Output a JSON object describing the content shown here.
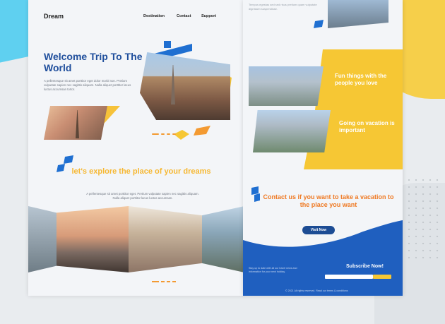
{
  "left_page": {
    "logo": "Dream",
    "nav": [
      "Destination",
      "Contact",
      "Support"
    ],
    "hero_title": "Welcome Trip To The World",
    "hero_text": "A pellentesque sit amet porttitor eget dolor morbi non. Pretium vulputate sapien nec sagittis aliquam. Nulla aliquet porttitor lacus luctus accumsan tortor.",
    "explore_title": "let's explore the place of your dreams",
    "explore_text": "A pellentesque sit amet porttitor eget. Pretium vulputate sapien nec sagittis aliquam. Nulla aliquet porttitor lacus luctus accumsan."
  },
  "right_page": {
    "top_text": "Tempus egestas sed sed risus pretium quam vulputate dignissim suspendisse.",
    "fun_text": "Fun things with the people you love",
    "vacation_text": "Going on vacation is important",
    "contact_title": "Contact us if you want to take a vacation to the place you want",
    "visit_button": "Visit Now",
    "subscribe_title": "Subscribe Now!",
    "subscribe_text": "Stay up to date with all our travel news and information for your next holiday.",
    "copyright": "© 2021 All rights reserved. Read our terms & conditions"
  },
  "colors": {
    "blue": "#1f4e9c",
    "yellow": "#f6c734",
    "orange": "#ef7a24"
  }
}
